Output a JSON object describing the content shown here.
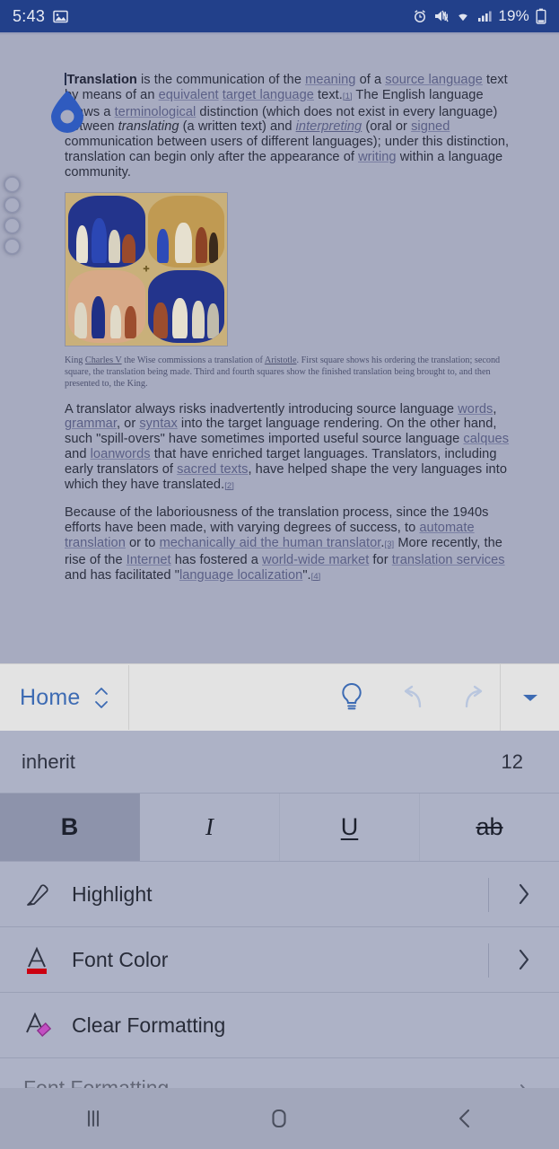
{
  "status_bar": {
    "time": "5:43",
    "battery_percent": "19%",
    "icons": [
      "image-icon",
      "alarm-icon",
      "mute-vibrate-icon",
      "wifi-icon",
      "signal-bars-icon",
      "battery-icon"
    ],
    "background_color": "#22408a"
  },
  "document": {
    "paragraph1": {
      "lead": "Translation",
      "t1": " is the communication of the ",
      "l1": "meaning",
      "t2": " of a ",
      "l2": "source language",
      "t3": " text by means of an ",
      "l3": "equivalent",
      "t4": " ",
      "l4": "target language",
      "t5": " text.",
      "r1": "[1]",
      "t6": " The English language draws a ",
      "l5": "terminological",
      "t7": " distinction (which does not exist in every language) between ",
      "em1": "translating",
      "t8": " (a written text) and ",
      "em2": "interpreting",
      "t9": " (oral or ",
      "l6": "signed",
      "t10": " communication between users of different languages); under this distinction, translation can begin only after the appearance of ",
      "l7": "writing",
      "t11": " within a language community."
    },
    "figure": {
      "caption_p1": "King ",
      "caption_l1": "Charles V",
      "caption_p2": " the Wise commissions a translation of ",
      "caption_l2": "Aristotle",
      "caption_p3": ". First square shows his ordering the translation; second square, the translation being made. Third and fourth squares show the finished translation being brought to, and then presented to, the King."
    },
    "paragraph2": {
      "t1": "A translator always risks inadvertently introducing source language ",
      "l1": "words",
      "t2": ", ",
      "l2": "grammar",
      "t3": ", or ",
      "l3": "syntax",
      "t4": " into the target language rendering. On the other hand, such \"spill-overs\" have sometimes imported useful source language ",
      "l4": "calques",
      "t5": " and ",
      "l5": "loanwords",
      "t6": " that have enriched target languages. Translators, including early translators of ",
      "l6": "sacred texts",
      "t7": ", have helped shape the very languages into which they have translated.",
      "r1": "[2]"
    },
    "paragraph3": {
      "t1": "Because of the laboriousness of the translation process, since the 1940s efforts have been made, with varying degrees of success, to ",
      "l1": "automate translation",
      "t2": " or to ",
      "l2": "mechanically aid the human translator",
      "t3": ".",
      "r1": "[3]",
      "t4": " More recently, the rise of the ",
      "l3": "Internet",
      "t5": " has fostered a ",
      "l4": "world-wide market",
      "t6": " for ",
      "l5": "translation services",
      "t7": " and has facilitated \"",
      "l6": "language localization",
      "t8": "\".",
      "r2": "[4]"
    }
  },
  "ribbon": {
    "tab_label": "Home",
    "accent_color": "#3d6bb3",
    "background_color": "#e3e3e3",
    "buttons": [
      {
        "name": "tell-me-lightbulb",
        "enabled": true
      },
      {
        "name": "undo",
        "enabled": false
      },
      {
        "name": "redo",
        "enabled": false
      },
      {
        "name": "expand-caret",
        "enabled": true
      }
    ]
  },
  "format_panel": {
    "background_color": "#adb2c6",
    "font_name": "inherit",
    "font_size": "12",
    "styles": [
      {
        "label": "B",
        "name": "bold",
        "active": true
      },
      {
        "label": "I",
        "name": "italic",
        "active": false
      },
      {
        "label": "U",
        "name": "underline",
        "active": false
      },
      {
        "label": "ab",
        "name": "strikethrough",
        "active": false
      }
    ],
    "items": [
      {
        "label": "Highlight",
        "icon": "highlighter-icon"
      },
      {
        "label": "Font Color",
        "icon": "font-color-icon",
        "swatch_color": "#cc0011"
      },
      {
        "label": "Clear Formatting",
        "icon": "clear-formatting-icon",
        "swatch_color": "#9b3a9b"
      }
    ],
    "partial_item": {
      "label": "Font Formatting"
    }
  },
  "nav_bar": {
    "background_color": "#a2a7bb",
    "buttons": [
      {
        "name": "recent-apps",
        "glyph": "|||"
      },
      {
        "name": "home",
        "glyph": "O"
      },
      {
        "name": "back",
        "glyph": "<"
      }
    ]
  }
}
